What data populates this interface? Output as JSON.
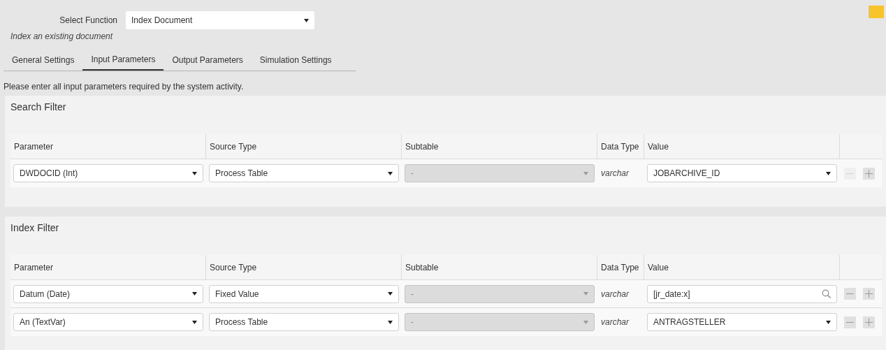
{
  "function": {
    "label": "Select Function",
    "value": "Index Document",
    "description": "Index an existing document"
  },
  "tabs": [
    {
      "label": "General Settings",
      "selected": false
    },
    {
      "label": "Input Parameters",
      "selected": true
    },
    {
      "label": "Output Parameters",
      "selected": false
    },
    {
      "label": "Simulation Settings",
      "selected": false
    }
  ],
  "intro": "Please enter all input parameters required by the system activity.",
  "sections": [
    {
      "title": "Search Filter",
      "columns": [
        "Parameter",
        "Source Type",
        "Subtable",
        "Data Type",
        "Value"
      ],
      "rows": [
        {
          "parameter": "DWDOCID (Int)",
          "source_type": "Process Table",
          "subtable": "-",
          "data_type": "varchar",
          "value": "JOBARCHIVE_ID",
          "kind": "select",
          "remove_disabled": true
        }
      ]
    },
    {
      "title": "Index Filter",
      "columns": [
        "Parameter",
        "Source Type",
        "Subtable",
        "Data Type",
        "Value"
      ],
      "rows": [
        {
          "parameter": "Datum (Date)",
          "source_type": "Fixed Value",
          "subtable": "-",
          "data_type": "varchar",
          "value": "[jr_date:x]",
          "kind": "search",
          "remove_disabled": false
        },
        {
          "parameter": "An (TextVar)",
          "source_type": "Process Table",
          "subtable": "-",
          "data_type": "varchar",
          "value": "ANTRAGSTELLER",
          "kind": "select",
          "remove_disabled": false
        }
      ]
    }
  ]
}
